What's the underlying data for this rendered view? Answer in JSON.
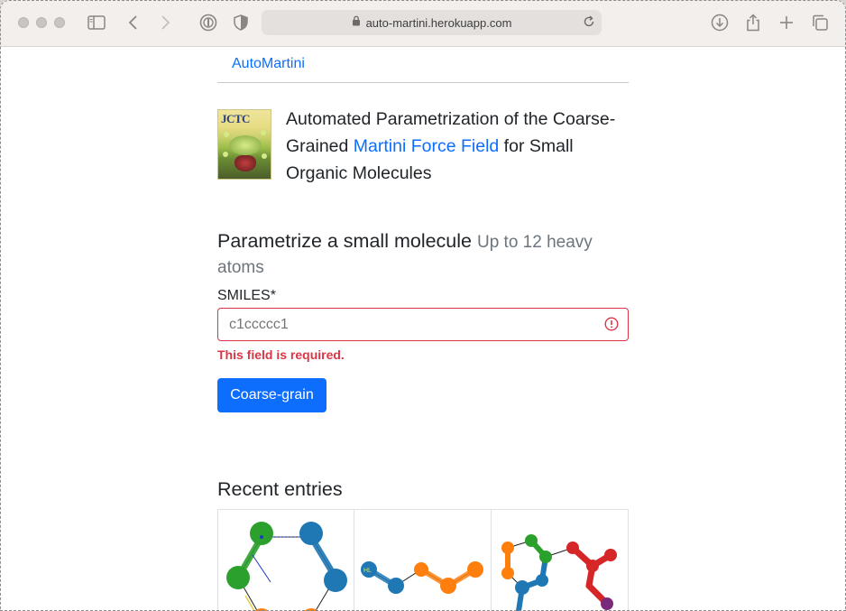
{
  "browser": {
    "url": "auto-martini.herokuapp.com"
  },
  "nav": {
    "brand": "AutoMartini"
  },
  "headline": {
    "before": "Automated Parametrization of the Coarse-Grained ",
    "link": "Martini Force Field",
    "after": " for Small Organic Molecules"
  },
  "cover": {
    "journal": "JCTC"
  },
  "form": {
    "title": "Parametrize a small molecule",
    "subtitle": "Up to 12 heavy atoms",
    "smiles_label": "SMILES*",
    "smiles_placeholder": "c1ccccc1",
    "error": "This field is required.",
    "submit_label": "Coarse-grain"
  },
  "recent": {
    "title": "Recent entries",
    "bead_label": "HL"
  },
  "colors": {
    "link": "#0d6efd",
    "error": "#dc3545",
    "bead_blue": "#1f77b4",
    "bead_orange": "#ff7f0e",
    "bead_green": "#2ca02c",
    "bead_red": "#d62728"
  }
}
